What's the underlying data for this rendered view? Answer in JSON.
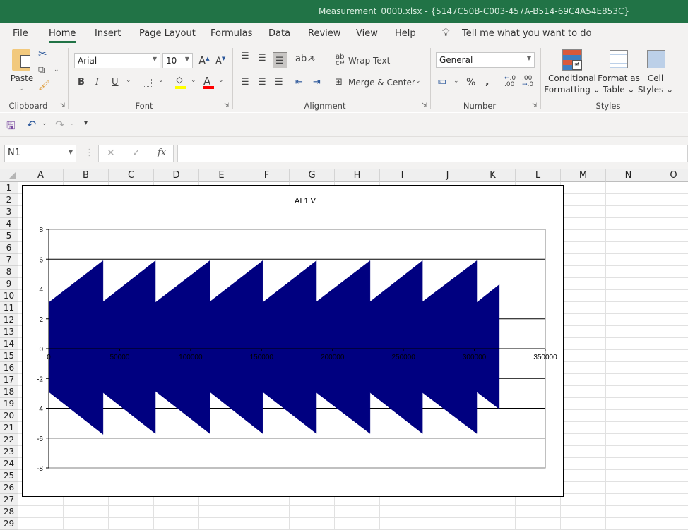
{
  "window": {
    "title": "Measurement_0000.xlsx  -  {5147C50B-C003-457A-B514-69C4A54E853C}",
    "accent": "#217346"
  },
  "tabs": [
    {
      "label": "File"
    },
    {
      "label": "Home",
      "active": true
    },
    {
      "label": "Insert"
    },
    {
      "label": "Page Layout"
    },
    {
      "label": "Formulas"
    },
    {
      "label": "Data"
    },
    {
      "label": "Review"
    },
    {
      "label": "View"
    },
    {
      "label": "Help"
    }
  ],
  "tell_me": {
    "placeholder": "Tell me what you want to do",
    "icon": "lightbulb-icon"
  },
  "ribbon": {
    "clipboard": {
      "label": "Clipboard",
      "paste": "Paste"
    },
    "font": {
      "label": "Font",
      "font_name": "Arial",
      "font_size": "10",
      "bold": "B",
      "italic": "I",
      "underline": "U",
      "fill_color": "#ffff00",
      "font_color": "#ff0000"
    },
    "alignment": {
      "label": "Alignment",
      "wrap_text": "Wrap Text",
      "merge_center": "Merge & Center"
    },
    "number": {
      "label": "Number",
      "format": "General",
      "percent": "%",
      "comma": ",",
      "inc_decimal": ".00",
      "dec_decimal": ".0"
    },
    "styles": {
      "label": "Styles",
      "conditional": [
        "Conditional",
        "Formatting"
      ],
      "format_table": [
        "Format as",
        "Table"
      ],
      "cell_styles": [
        "Cell",
        "Styles"
      ]
    }
  },
  "formula_bar": {
    "name_box": "N1",
    "cancel": "✕",
    "enter": "✓",
    "fx": "fx",
    "value": ""
  },
  "sheet": {
    "columns": [
      "A",
      "B",
      "C",
      "D",
      "E",
      "F",
      "G",
      "H",
      "I",
      "J",
      "K",
      "L",
      "M",
      "N",
      "O"
    ],
    "rows": [
      1,
      2,
      3,
      4,
      5,
      6,
      7,
      8,
      9,
      10,
      11,
      12,
      13,
      14,
      15,
      16,
      17,
      18,
      19,
      20,
      21,
      22,
      23,
      24,
      25,
      26,
      27,
      28,
      29
    ]
  },
  "chart_data": {
    "type": "area",
    "title": "AI 1 V",
    "xlim": [
      0,
      350000
    ],
    "ylim": [
      -8,
      8
    ],
    "x_ticks": [
      0,
      50000,
      100000,
      150000,
      200000,
      250000,
      300000,
      350000
    ],
    "y_ticks": [
      -8,
      -6,
      -4,
      -2,
      0,
      2,
      4,
      6,
      8
    ],
    "grid": "horizontal major",
    "legend": "none",
    "series_color": "#000080",
    "upper_envelope": [
      [
        0,
        3.1
      ],
      [
        38300,
        5.9
      ],
      [
        38300,
        3.15
      ],
      [
        75200,
        5.9
      ],
      [
        75200,
        3.1
      ],
      [
        113500,
        5.9
      ],
      [
        113500,
        3.15
      ],
      [
        150800,
        5.9
      ],
      [
        150800,
        3.1
      ],
      [
        188700,
        5.9
      ],
      [
        188700,
        3.15
      ],
      [
        226500,
        5.9
      ],
      [
        226500,
        3.15
      ],
      [
        263400,
        5.9
      ],
      [
        263400,
        3.15
      ],
      [
        301700,
        5.9
      ],
      [
        301700,
        3.1
      ],
      [
        317600,
        4.3
      ]
    ],
    "lower_envelope": [
      [
        0,
        -2.9
      ],
      [
        38300,
        -5.75
      ],
      [
        38300,
        -2.95
      ],
      [
        75200,
        -5.7
      ],
      [
        75200,
        -2.85
      ],
      [
        113500,
        -5.7
      ],
      [
        113500,
        -2.9
      ],
      [
        150800,
        -5.7
      ],
      [
        150800,
        -2.9
      ],
      [
        188700,
        -5.7
      ],
      [
        188700,
        -2.95
      ],
      [
        226500,
        -5.7
      ],
      [
        226500,
        -2.95
      ],
      [
        263400,
        -5.7
      ],
      [
        263400,
        -2.95
      ],
      [
        301700,
        -5.7
      ],
      [
        301700,
        -2.9
      ],
      [
        317600,
        -4.05
      ]
    ]
  }
}
